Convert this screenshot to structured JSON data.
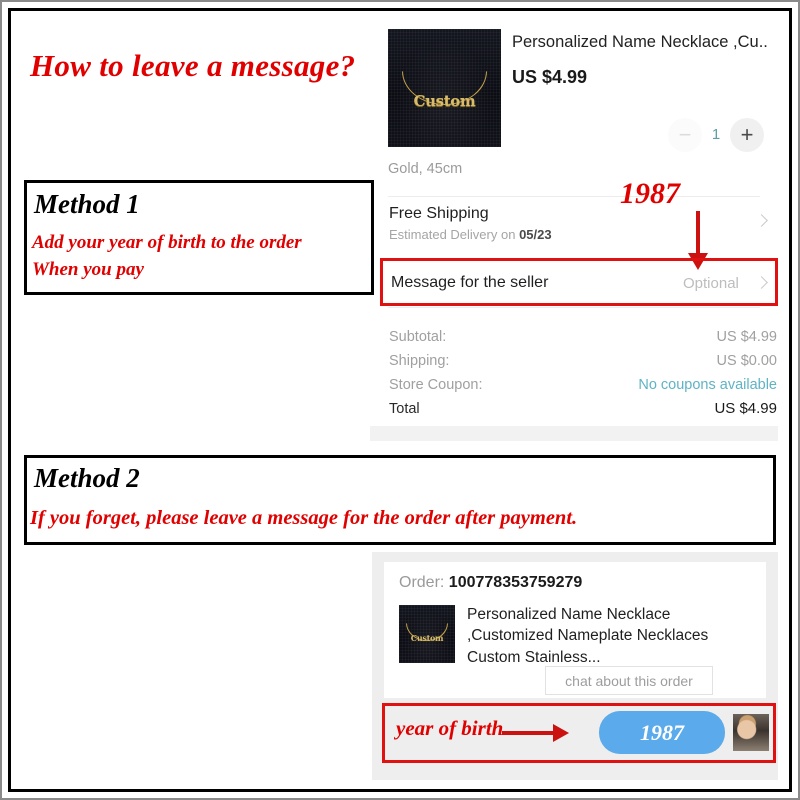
{
  "title": "How to leave a message?",
  "method1": {
    "heading": "Method 1",
    "line1": "Add your year of birth to the order",
    "line2": "When you pay"
  },
  "method2": {
    "heading": "Method 2",
    "line1": "If you forget, please leave a message for the order after payment."
  },
  "annotations": {
    "year_top": "1987",
    "year_of_birth_label": "year of birth",
    "bubble_year": "1987",
    "accent_red": "#e00000",
    "arrow_red": "#cc1111",
    "highlight_red": "#e01111"
  },
  "cart": {
    "product": {
      "title": "Personalized Name Necklace ,Cu...",
      "price": "US $4.99",
      "variant": "Gold, 45cm",
      "image_text": "Custom"
    },
    "quantity": {
      "decrease_label": "−",
      "value": "1",
      "increase_label": "+"
    },
    "shipping": {
      "title": "Free Shipping",
      "estimate_prefix": "Estimated Delivery on ",
      "estimate_date": "05/23"
    },
    "message_row": {
      "label": "Message for the seller",
      "value": "Optional"
    },
    "totals": [
      {
        "label": "Subtotal:",
        "value": "US $4.99",
        "style": "muted"
      },
      {
        "label": "Shipping:",
        "value": "US $0.00",
        "style": "muted"
      },
      {
        "label": "Store Coupon:",
        "value": "No coupons available",
        "style": "link"
      },
      {
        "label": "Total",
        "value": "US $4.99",
        "style": "strong"
      }
    ]
  },
  "order": {
    "order_prefix": "Order: ",
    "order_number": "100778353759279",
    "item_title": "Personalized Name Necklace ,Customized Nameplate Necklaces Custom Stainless...",
    "item_image_text": "Custom",
    "chat_button": "chat about this order"
  }
}
